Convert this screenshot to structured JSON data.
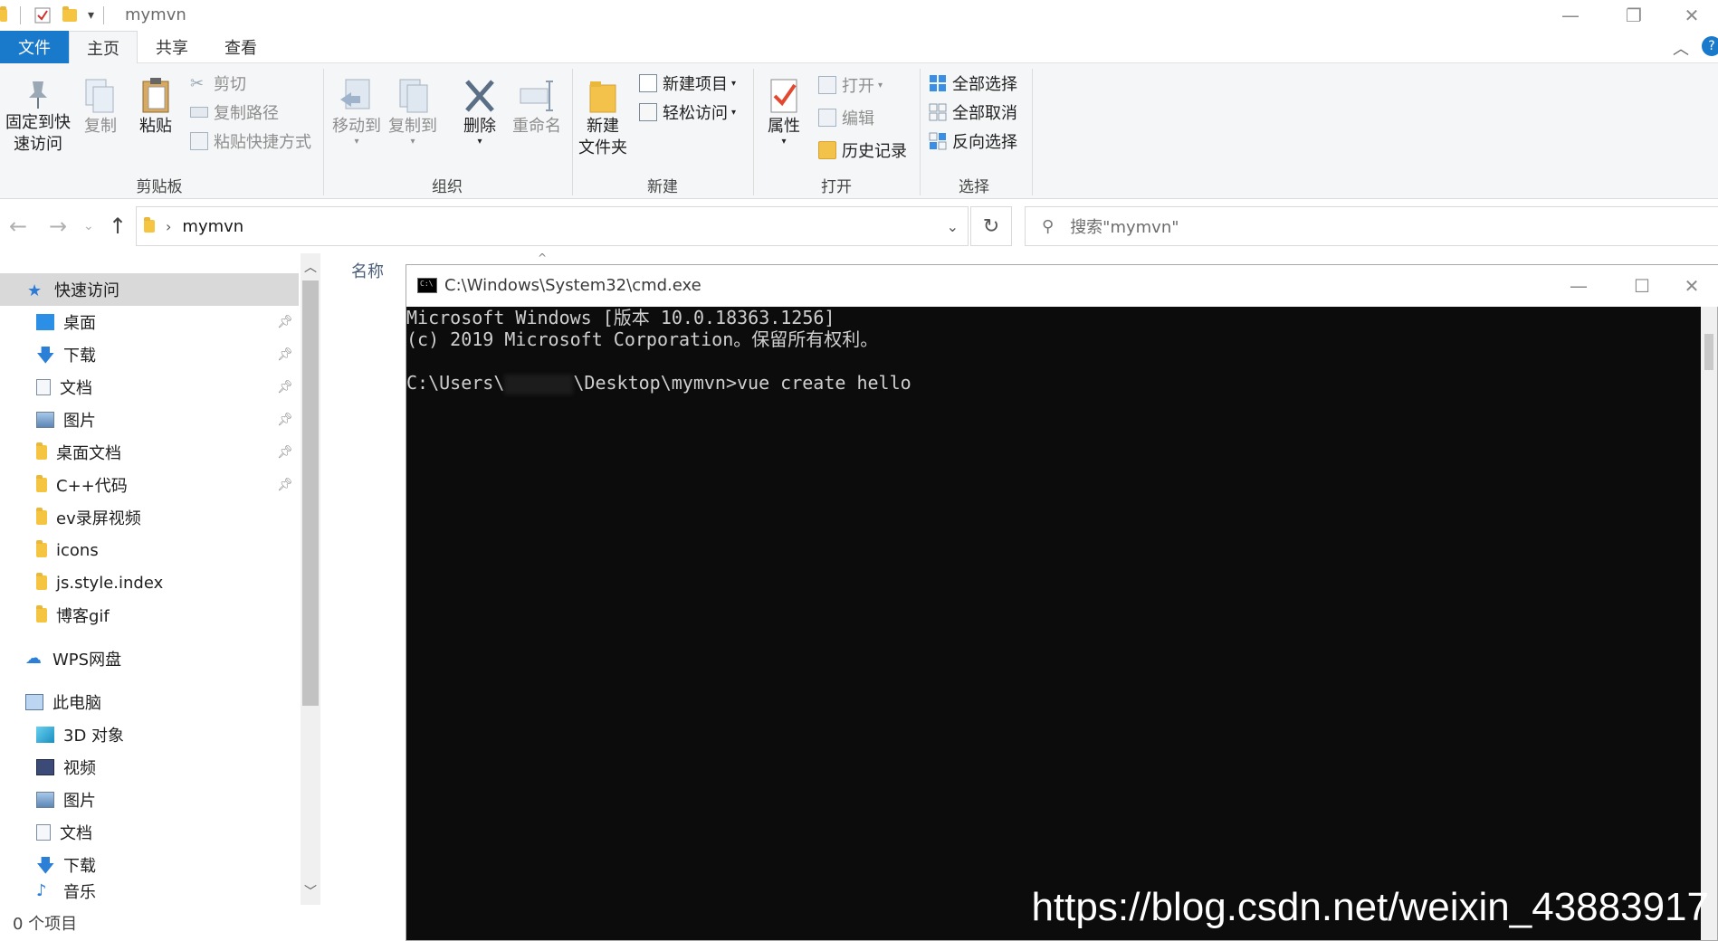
{
  "titlebar": {
    "title": "mymvn",
    "qa_dropdown": "▾"
  },
  "tabs": [
    "文件",
    "主页",
    "共享",
    "查看"
  ],
  "ribbon": {
    "clipboard": {
      "label": "剪贴板",
      "pin_label_1": "固定到快",
      "pin_label_2": "速访问",
      "copy": "复制",
      "paste": "粘贴",
      "cut": "剪切",
      "copy_path": "复制路径",
      "paste_shortcut": "粘贴快捷方式"
    },
    "organize": {
      "label": "组织",
      "move_to": "移动到",
      "copy_to": "复制到",
      "delete": "删除",
      "rename": "重命名"
    },
    "new": {
      "label": "新建",
      "new_folder_1": "新建",
      "new_folder_2": "文件夹",
      "new_item": "新建项目",
      "easy_access": "轻松访问"
    },
    "open": {
      "label": "打开",
      "properties": "属性",
      "open": "打开",
      "edit": "编辑",
      "history": "历史记录"
    },
    "select": {
      "label": "选择",
      "select_all": "全部选择",
      "select_none": "全部取消",
      "invert": "反向选择"
    }
  },
  "address": {
    "path": "mymvn",
    "search_placeholder": "搜索\"mymvn\""
  },
  "nav": {
    "quick_access": "快速访问",
    "items": [
      "桌面",
      "下载",
      "文档",
      "图片",
      "桌面文档",
      "C++代码",
      "ev录屏视频",
      "icons",
      "js.style.index",
      "博客gif"
    ],
    "wps": "WPS网盘",
    "this_pc": "此电脑",
    "pc_items": [
      "3D 对象",
      "视频",
      "图片",
      "文档",
      "下载",
      "音乐"
    ]
  },
  "content": {
    "col_name": "名称"
  },
  "status": {
    "count": "0 个项目"
  },
  "cmd": {
    "title": "C:\\Windows\\System32\\cmd.exe",
    "line1": "Microsoft Windows [版本 10.0.18363.1256]",
    "line2": "(c) 2019 Microsoft Corporation。保留所有权利。",
    "prompt_prefix": "C:\\Users\\",
    "prompt_suffix": "\\Desktop\\mymvn>vue create hello"
  },
  "watermark": {
    "url": "https://blog.csdn.net/weixin_43883917"
  },
  "colors": {
    "accent": "#1979ca",
    "console_bg": "#0c0c0c",
    "console_text": "#cfcfcf"
  }
}
